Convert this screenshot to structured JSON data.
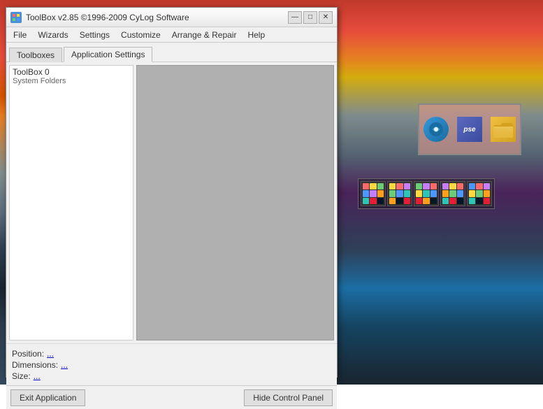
{
  "desktop": {
    "background_desc": "Mountain landscape at sunset"
  },
  "window": {
    "title": "ToolBox v2.85 ©1996-2009 CyLog Software",
    "title_btn_minimize": "—",
    "title_btn_maximize": "□",
    "title_btn_close": "✕"
  },
  "menu": {
    "items": [
      "File",
      "Wizards",
      "Settings",
      "Customize",
      "Arrange & Repair",
      "Help"
    ]
  },
  "tabs": [
    {
      "label": "Toolboxes",
      "active": false
    },
    {
      "label": "Application Settings",
      "active": true
    }
  ],
  "toolbox_list": {
    "items": [
      {
        "title": "ToolBox 0",
        "subtitle": "System Folders"
      }
    ]
  },
  "status": {
    "position_label": "Position:",
    "position_value": "...",
    "dimensions_label": "Dimensions:",
    "dimensions_value": "...",
    "size_label": "Size:",
    "size_value": "..."
  },
  "buttons": {
    "exit_label": "Exit Application",
    "hide_label": "Hide Control Panel"
  },
  "desktop_icons": {
    "icon1_label": "",
    "icon2_label": "pse",
    "icon3_label": "📁"
  },
  "grid_icons": {
    "colors_set1": [
      "#ff6b6b",
      "#ffd93d",
      "#6bcb77",
      "#4d96ff",
      "#c77dff",
      "#ff9f1c",
      "#2ec4b6",
      "#e71d36",
      "#011627"
    ],
    "colors_set2": [
      "#ff6b6b",
      "#ffd93d",
      "#6bcb77",
      "#4d96ff",
      "#c77dff",
      "#ff9f1c",
      "#2ec4b6",
      "#e71d36",
      "#011627"
    ],
    "colors_set3": [
      "#ff6b6b",
      "#ffd93d",
      "#6bcb77",
      "#4d96ff",
      "#c77dff",
      "#ff9f1c",
      "#2ec4b6",
      "#e71d36",
      "#011627"
    ],
    "colors_set4": [
      "#c77dff",
      "#ff9f1c",
      "#2ec4b6",
      "#ffd93d",
      "#6bcb77",
      "#4d96ff",
      "#ff6b6b",
      "#e71d36",
      "#011627"
    ],
    "colors_set5": [
      "#4d96ff",
      "#c77dff",
      "#ff9f1c",
      "#6bcb77",
      "#ffd93d",
      "#ff6b6b",
      "#2ec4b6",
      "#011627",
      "#e71d36"
    ]
  }
}
